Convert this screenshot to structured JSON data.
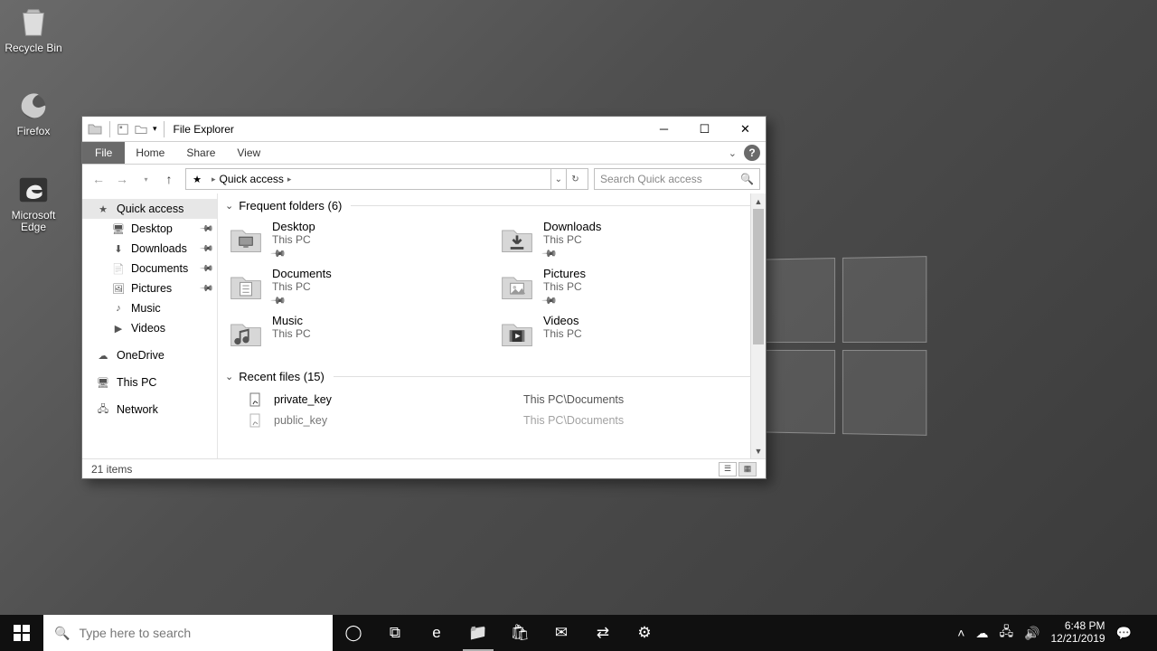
{
  "desktop": {
    "icons": [
      {
        "name": "Recycle Bin"
      },
      {
        "name": "Firefox"
      },
      {
        "name": "Microsoft Edge"
      }
    ]
  },
  "window": {
    "title": "File Explorer",
    "tabs": {
      "file": "File",
      "home": "Home",
      "share": "Share",
      "view": "View"
    },
    "breadcrumb": {
      "location": "Quick access"
    },
    "search_placeholder": "Search Quick access",
    "status_text": "21 items"
  },
  "navpane": {
    "quick_access": "Quick access",
    "items": [
      {
        "label": "Desktop",
        "pinned": true
      },
      {
        "label": "Downloads",
        "pinned": true
      },
      {
        "label": "Documents",
        "pinned": true
      },
      {
        "label": "Pictures",
        "pinned": true
      },
      {
        "label": "Music",
        "pinned": false
      },
      {
        "label": "Videos",
        "pinned": false
      }
    ],
    "onedrive": "OneDrive",
    "thispc": "This PC",
    "network": "Network"
  },
  "content": {
    "frequent_hdr": "Frequent folders (6)",
    "recent_hdr": "Recent files (15)",
    "frequent": [
      {
        "name": "Desktop",
        "loc": "This PC",
        "pinned": true,
        "icon": "desktop"
      },
      {
        "name": "Downloads",
        "loc": "This PC",
        "pinned": true,
        "icon": "downloads"
      },
      {
        "name": "Documents",
        "loc": "This PC",
        "pinned": true,
        "icon": "documents"
      },
      {
        "name": "Pictures",
        "loc": "This PC",
        "pinned": true,
        "icon": "pictures"
      },
      {
        "name": "Music",
        "loc": "This PC",
        "pinned": false,
        "icon": "music"
      },
      {
        "name": "Videos",
        "loc": "This PC",
        "pinned": false,
        "icon": "videos"
      }
    ],
    "recent": [
      {
        "name": "private_key",
        "path": "This PC\\Documents"
      },
      {
        "name": "public_key",
        "path": "This PC\\Documents"
      }
    ]
  },
  "taskbar": {
    "search_placeholder": "Type here to search",
    "time": "6:48 PM",
    "date": "12/21/2019"
  }
}
